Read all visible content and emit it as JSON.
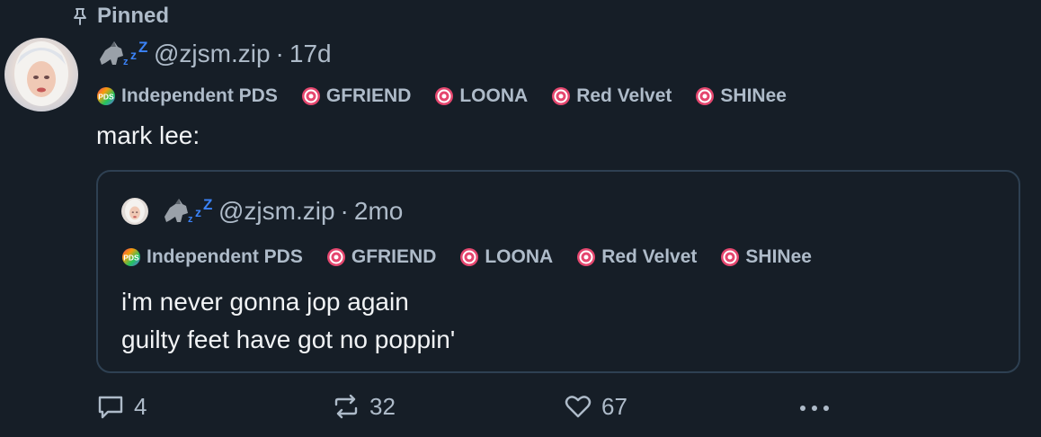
{
  "pinned": {
    "label": "Pinned",
    "icon": "pin-icon"
  },
  "post": {
    "handle": "@zjsm.zip",
    "time_sep": "·",
    "time": "17d",
    "labels": [
      {
        "text": "Independent PDS",
        "icon": "pds-icon"
      },
      {
        "text": "GFRIEND",
        "icon": "label-check-icon"
      },
      {
        "text": "LOONA",
        "icon": "label-check-icon"
      },
      {
        "text": "Red Velvet",
        "icon": "label-check-icon"
      },
      {
        "text": "SHINee",
        "icon": "label-check-icon"
      }
    ],
    "text": "mark lee:"
  },
  "quote": {
    "handle": "@zjsm.zip",
    "time_sep": "·",
    "time": "2mo",
    "labels": [
      {
        "text": "Independent PDS",
        "icon": "pds-icon"
      },
      {
        "text": "GFRIEND",
        "icon": "label-check-icon"
      },
      {
        "text": "LOONA",
        "icon": "label-check-icon"
      },
      {
        "text": "Red Velvet",
        "icon": "label-check-icon"
      },
      {
        "text": "SHINee",
        "icon": "label-check-icon"
      }
    ],
    "line1": "i'm never gonna jop again",
    "line2": "guilty feet have got no poppin'"
  },
  "actions": {
    "reply_count": "4",
    "repost_count": "32",
    "like_count": "67",
    "more_icon": "more-icon"
  },
  "colors": {
    "background": "#161e27",
    "muted": "#aebbc9",
    "text": "#f1f3f5",
    "border": "#2e4052",
    "label_pink": "#e5476f"
  }
}
